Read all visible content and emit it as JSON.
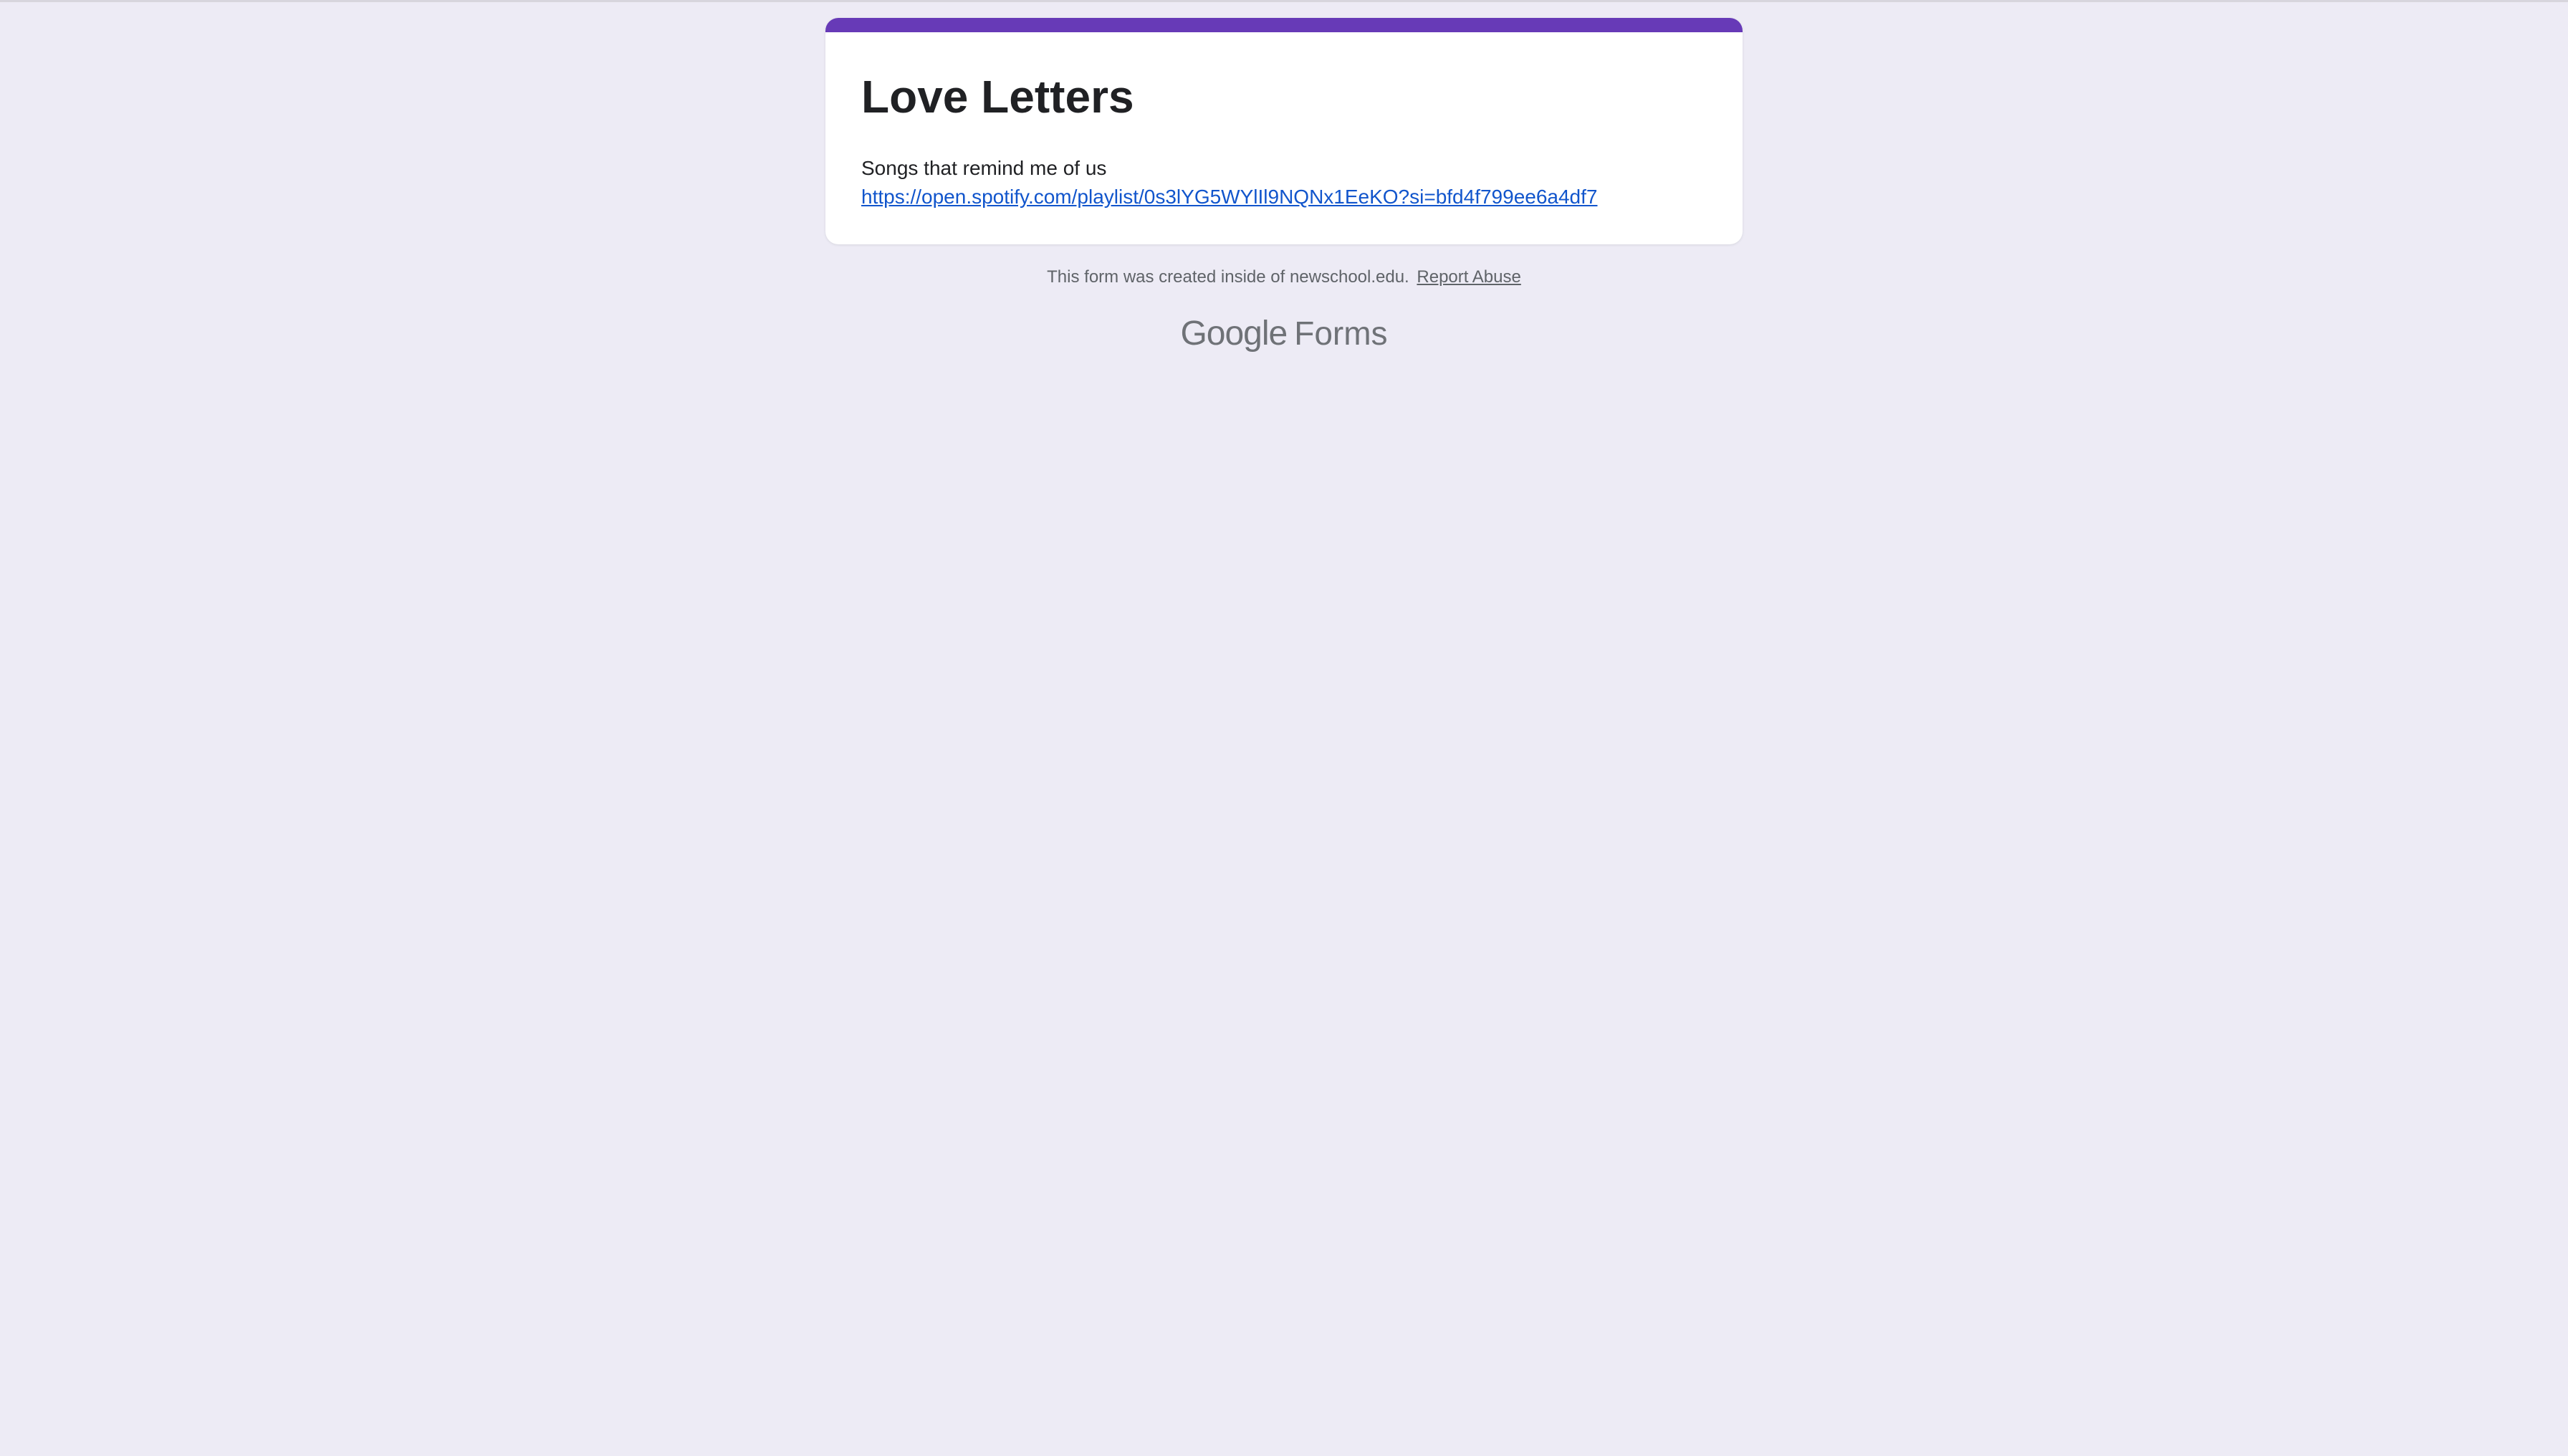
{
  "form": {
    "accent_color": "#673ab7",
    "title": "Love Letters",
    "description": "Songs that remind me of us",
    "link_text": "https://open.spotify.com/playlist/0s3lYG5WYlIl9NQNx1EeKO?si=bfd4f799ee6a4df7"
  },
  "footer": {
    "note": "This form was created inside of newschool.edu.",
    "report_label": "Report Abuse"
  },
  "brand": {
    "google": "Google",
    "forms": "Forms"
  }
}
